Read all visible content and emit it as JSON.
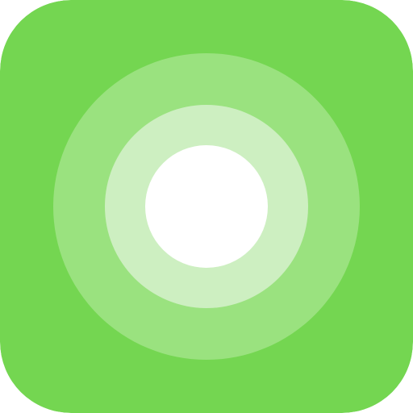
{
  "app_icon": {
    "name": "assistive-touch-icon",
    "colors": {
      "background": "#74D651",
      "outer_ring": "#9AE27F",
      "middle_ring": "#CDEFC1",
      "center_dot": "#FFFFFF"
    }
  }
}
